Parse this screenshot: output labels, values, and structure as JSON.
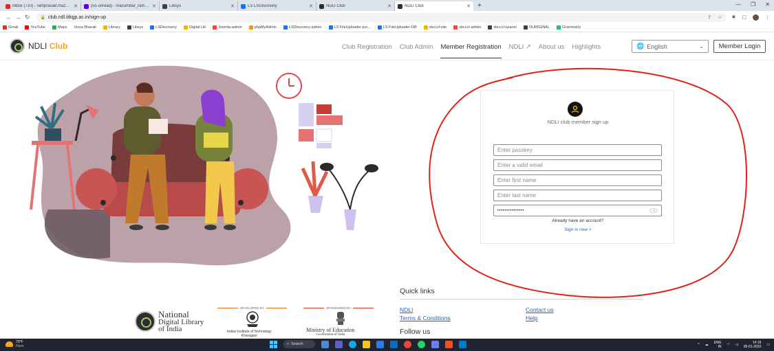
{
  "browser": {
    "tabs": [
      {
        "title": "Inbox (710) - ramprasad.mazum...",
        "fav": "#d93025",
        "active": false
      },
      {
        "title": "(55 unread) - mazumdar_ram@y...",
        "fav": "#6001d2",
        "active": false
      },
      {
        "title": "Libsys",
        "fav": "#3c4043",
        "active": false
      },
      {
        "title": "LS LSDiscovery",
        "fav": "#1a73e8",
        "active": false
      },
      {
        "title": "NDLI Club",
        "fav": "#2e2e2e",
        "active": false
      },
      {
        "title": "NDLI Club",
        "fav": "#2e2e2e",
        "active": true
      }
    ],
    "new_tab": "+",
    "url": "club.ndl.iitkgp.ac.in/sign-up",
    "bookmarks": [
      {
        "label": "Gmail",
        "color": "#d93025"
      },
      {
        "label": "YouTube",
        "color": "#ff0000"
      },
      {
        "label": "Maps",
        "color": "#34a853"
      },
      {
        "label": "Visva Bharati",
        "color": ""
      },
      {
        "label": "Library",
        "color": "#f4b400"
      },
      {
        "label": "Libsys",
        "color": "#3c4043"
      },
      {
        "label": "LSDiscovery",
        "color": "#1a73e8"
      },
      {
        "label": "Digital Lib",
        "color": "#f4b400"
      },
      {
        "label": "Joomla-admin",
        "color": "#f44336"
      },
      {
        "label": "phpMyAdmin",
        "color": "#f89406"
      },
      {
        "label": "LSDiscovery-admin",
        "color": "#1a73e8"
      },
      {
        "label": "LS FileUploader-joo...",
        "color": "#1a73e8"
      },
      {
        "label": "LS FileUploader-DB",
        "color": "#1a73e8"
      },
      {
        "label": "vbcccl-site",
        "color": "#f4b400"
      },
      {
        "label": "vbcccl-admin",
        "color": "#f44336"
      },
      {
        "label": "vbcccl-cpanel",
        "color": "#3c4043"
      },
      {
        "label": "OURIGINAL",
        "color": "#3c4043"
      },
      {
        "label": "Grammarly",
        "color": "#15c39a"
      }
    ]
  },
  "header": {
    "logo_text": "NDLI",
    "logo_accent": "Club",
    "nav": [
      {
        "label": "Club Registration",
        "active": false
      },
      {
        "label": "Club Admin",
        "active": false
      },
      {
        "label": "Member Registration",
        "active": true
      },
      {
        "label": "NDLI ↗",
        "active": false
      },
      {
        "label": "About us",
        "active": false
      },
      {
        "label": "Highlights",
        "active": false
      }
    ],
    "language": "English",
    "login_label": "Member Login"
  },
  "signup": {
    "title": "NDLI club member sign up",
    "fields": [
      {
        "placeholder": "Enter passkey",
        "value": ""
      },
      {
        "placeholder": "Enter a valid email",
        "value": ""
      },
      {
        "placeholder": "Enter first name",
        "value": ""
      },
      {
        "placeholder": "Enter last name",
        "value": ""
      }
    ],
    "password_value": "•••••••••••••••",
    "have_account": "Already have an account?",
    "sign_in": "Sign in now >"
  },
  "footer": {
    "quick_links_title": "Quick links",
    "links": [
      "NDLI",
      "Terms & Conditions",
      "Contact us",
      "Help"
    ],
    "follow_us": "Follow us",
    "ndl_name": [
      "National",
      "Digital Library",
      "of India"
    ],
    "developed_by": "DEVELOPED BY",
    "sponsored_by": "SPONSORED BY",
    "iit_text": [
      "Indian Institute of Technology",
      "Kharagpur"
    ],
    "moe_text": [
      "Ministry of Education",
      "Government of India"
    ]
  },
  "taskbar": {
    "weather_temp": "70°F",
    "weather_desc": "Haze",
    "search_label": "Search",
    "lang": [
      "ENG",
      "IN"
    ],
    "time": "14:19",
    "date": "05-01-2023"
  },
  "colors": {
    "annotation": "#e0201b",
    "link": "#2c5fb8",
    "accent": "#f5a623"
  }
}
